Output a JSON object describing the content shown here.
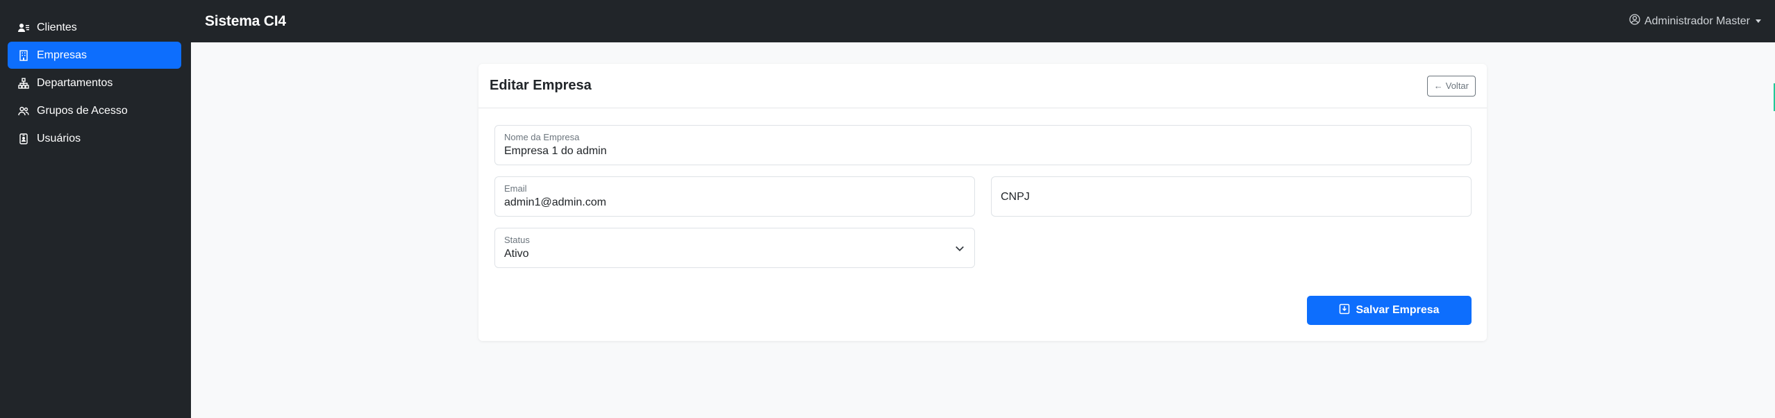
{
  "sidebar": {
    "items": [
      {
        "label": "Clientes",
        "icon": "user-list-icon",
        "active": false
      },
      {
        "label": "Empresas",
        "icon": "building-icon",
        "active": true
      },
      {
        "label": "Departamentos",
        "icon": "diagram-icon",
        "active": false
      },
      {
        "label": "Grupos de Acesso",
        "icon": "people-icon",
        "active": false
      },
      {
        "label": "Usuários",
        "icon": "id-badge-icon",
        "active": false
      }
    ]
  },
  "topbar": {
    "brand": "Sistema CI4",
    "user": "Administrador Master"
  },
  "card": {
    "title": "Editar Empresa",
    "back_label": "Voltar"
  },
  "form": {
    "nome": {
      "label": "Nome da Empresa",
      "value": "Empresa 1 do admin"
    },
    "email": {
      "label": "Email",
      "value": "admin1@admin.com"
    },
    "cnpj": {
      "placeholder": "CNPJ"
    },
    "status": {
      "label": "Status",
      "value": "Ativo"
    },
    "save_label": "Salvar Empresa"
  },
  "colors": {
    "primary": "#0d6efd",
    "dark": "#212529",
    "background": "#f8f9fa"
  }
}
